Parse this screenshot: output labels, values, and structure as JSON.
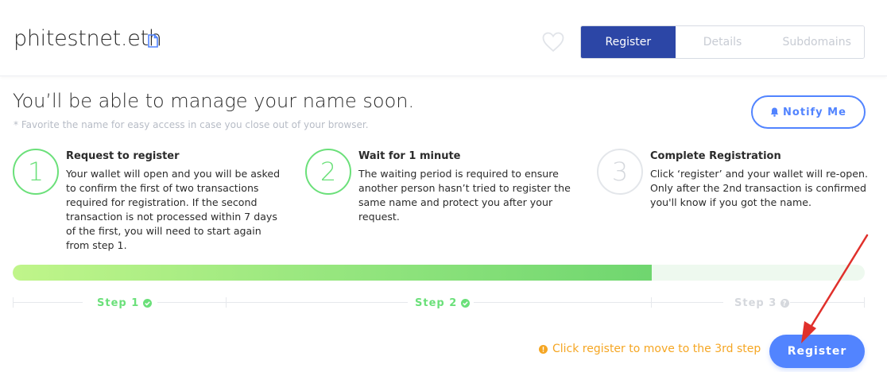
{
  "header": {
    "domain_name": "phitestnet.eth",
    "tabs": [
      {
        "label": "Register",
        "active": true
      },
      {
        "label": "Details",
        "active": false
      },
      {
        "label": "Subdomains",
        "active": false
      }
    ]
  },
  "main": {
    "title": "You’ll be able to manage your name soon.",
    "subtitle": "* Favorite the name for easy access in case you close out of your browser.",
    "notify_label": "Notify Me",
    "steps": [
      {
        "number": "1",
        "title": "Request to register",
        "lines": [
          "Your wallet will open and you will be asked",
          "to confirm the first of two transactions",
          "required for registration. If the second",
          "transaction is not processed within 7 days",
          "of the first, you will need to start again",
          "from step 1."
        ],
        "status": "done"
      },
      {
        "number": "2",
        "title": "Wait for 1 minute",
        "lines": [
          "The waiting period is required to ensure",
          "another person hasn’t tried to register the",
          "same name and protect you after your",
          "request."
        ],
        "status": "done"
      },
      {
        "number": "3",
        "title": "Complete Registration",
        "lines": [
          "Click ‘register’ and your wallet will re-open.",
          "Only after the 2nd transaction is confirmed",
          "you'll know if you got the name."
        ],
        "status": "pending"
      }
    ],
    "progress_fraction": 0.75,
    "timeline": [
      {
        "label": "Step 1",
        "status": "done",
        "icon": "check-icon"
      },
      {
        "label": "Step 2",
        "status": "done",
        "icon": "check-icon"
      },
      {
        "label": "Step 3",
        "status": "pending",
        "icon": "question-icon"
      }
    ],
    "hint": "Click register to move to the 3rd step",
    "register_label": "Register"
  },
  "colors": {
    "brand_blue": "#2c46a6",
    "accent_blue": "#5284ff",
    "success_green": "#6be07a",
    "warning_orange": "#f5a623",
    "annotation_red": "#e0302b"
  }
}
